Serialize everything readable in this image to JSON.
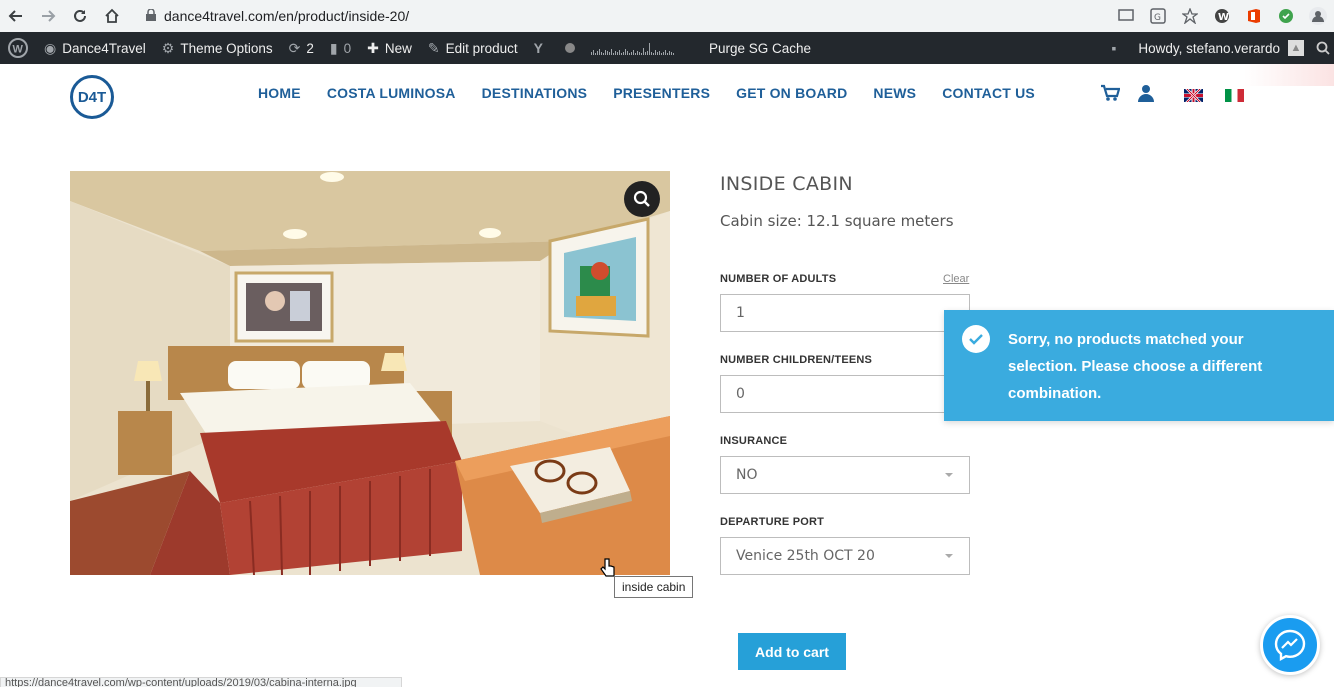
{
  "browser": {
    "url": "dance4travel.com/en/product/inside-20/",
    "back_icon": "arrow-left",
    "forward_icon": "arrow-right",
    "reload_icon": "reload",
    "home_icon": "home"
  },
  "admin_bar": {
    "site_name": "Dance4Travel",
    "theme_options": "Theme Options",
    "updates_count": "2",
    "comments_count": "0",
    "new_label": "New",
    "edit_label": "Edit product",
    "purge_label": "Purge SG Cache",
    "howdy": "Howdy, stefano.verardo"
  },
  "header": {
    "logo_text": "D4T",
    "nav": [
      "HOME",
      "COSTA LUMINOSA",
      "DESTINATIONS",
      "PRESENTERS",
      "GET ON BOARD",
      "NEWS",
      "CONTACT US"
    ]
  },
  "product": {
    "title": "INSIDE CABIN",
    "cabin_size": "Cabin size: 12.1 square meters",
    "image_tooltip": "inside cabin",
    "fields": {
      "adults_label": "NUMBER OF ADULTS",
      "adults_value": "1",
      "clear_label": "Clear",
      "children_label": "NUMBER CHILDREN/TEENS",
      "children_value": "0",
      "insurance_label": "INSURANCE",
      "insurance_value": "NO",
      "port_label": "DEPARTURE PORT",
      "port_value": "Venice 25th OCT 20"
    },
    "add_to_cart": "Add to cart"
  },
  "notice": {
    "message": "Sorry, no products matched your selection. Please choose a different combination."
  },
  "status_bar": {
    "url": "https://dance4travel.com/wp-content/uploads/2019/03/cabina-interna.jpg"
  },
  "colors": {
    "nav_blue": "#1f5f99",
    "notice_blue": "#3aabdf",
    "button_blue": "#26a0d8",
    "admin_bar": "#23282d"
  }
}
